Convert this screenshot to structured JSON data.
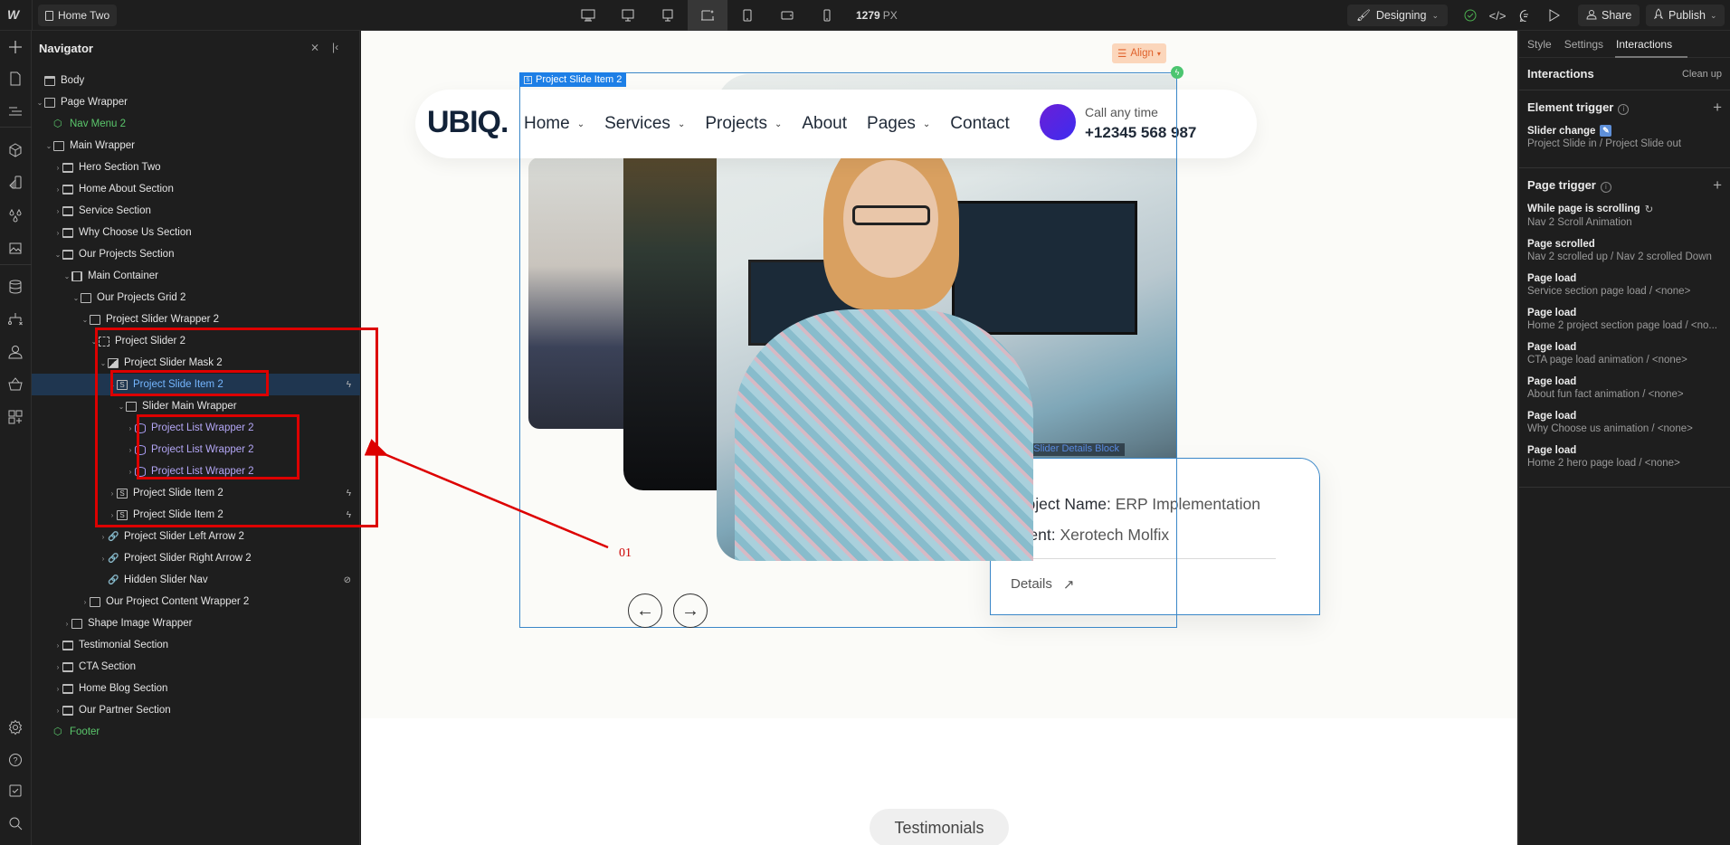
{
  "topbar": {
    "page_name": "Home Two",
    "devices": [
      "desktop-large-icon",
      "desktop-icon",
      "desktop-base-icon",
      "laptop-star-icon",
      "tablet-icon",
      "mobile-landscape-icon",
      "mobile-portrait-icon"
    ],
    "width_value": "1279",
    "width_unit": "PX",
    "mode_label": "Designing",
    "share_label": "Share",
    "publish_label": "Publish"
  },
  "navigator": {
    "title": "Navigator",
    "items": [
      {
        "label": "Body",
        "depth": 0,
        "icon": "body",
        "caret": "",
        "color": ""
      },
      {
        "label": "Page Wrapper",
        "depth": 0,
        "icon": "box",
        "caret": "down",
        "color": ""
      },
      {
        "label": "Nav Menu 2",
        "depth": 1,
        "icon": "component",
        "caret": "",
        "color": "green"
      },
      {
        "label": "Main Wrapper",
        "depth": 1,
        "icon": "box",
        "caret": "down",
        "color": ""
      },
      {
        "label": "Hero Section  Two",
        "depth": 2,
        "icon": "section",
        "caret": "right",
        "color": ""
      },
      {
        "label": "Home About Section",
        "depth": 2,
        "icon": "section",
        "caret": "right",
        "color": ""
      },
      {
        "label": "Service Section",
        "depth": 2,
        "icon": "section",
        "caret": "right",
        "color": ""
      },
      {
        "label": "Why Choose Us Section",
        "depth": 2,
        "icon": "section",
        "caret": "right",
        "color": ""
      },
      {
        "label": "Our Projects Section",
        "depth": 2,
        "icon": "section",
        "caret": "down",
        "color": ""
      },
      {
        "label": "Main Container",
        "depth": 3,
        "icon": "container",
        "caret": "down",
        "color": ""
      },
      {
        "label": "Our Projects Grid 2",
        "depth": 4,
        "icon": "box",
        "caret": "down",
        "color": ""
      },
      {
        "label": "Project Slider Wrapper 2",
        "depth": 5,
        "icon": "box",
        "caret": "down",
        "color": ""
      },
      {
        "label": "Project Slider 2",
        "depth": 6,
        "icon": "slider",
        "caret": "down",
        "color": ""
      },
      {
        "label": "Project Slider Mask 2",
        "depth": 7,
        "icon": "mask",
        "caret": "down",
        "color": ""
      },
      {
        "label": "Project Slide Item 2",
        "depth": 8,
        "icon": "slide",
        "caret": "down",
        "color": "blue",
        "selected": true,
        "bolt": true
      },
      {
        "label": "Slider Main Wrapper",
        "depth": 9,
        "icon": "box",
        "caret": "down",
        "color": ""
      },
      {
        "label": "Project List Wrapper 2",
        "depth": 10,
        "icon": "collection",
        "caret": "right",
        "color": "purple"
      },
      {
        "label": "Project List Wrapper 2",
        "depth": 10,
        "icon": "collection",
        "caret": "right",
        "color": "purple"
      },
      {
        "label": "Project List Wrapper 2",
        "depth": 10,
        "icon": "collection",
        "caret": "right",
        "color": "purple"
      },
      {
        "label": "Project Slide Item 2",
        "depth": 8,
        "icon": "slide",
        "caret": "right",
        "color": "",
        "bolt": true
      },
      {
        "label": "Project Slide Item 2",
        "depth": 8,
        "icon": "slide",
        "caret": "right",
        "color": "",
        "bolt": true
      },
      {
        "label": "Project Slider Left Arrow 2",
        "depth": 7,
        "icon": "link",
        "caret": "right",
        "color": ""
      },
      {
        "label": "Project Slider Right Arrow 2",
        "depth": 7,
        "icon": "link",
        "caret": "right",
        "color": ""
      },
      {
        "label": "Hidden Slider Nav",
        "depth": 7,
        "icon": "link",
        "caret": "",
        "color": "",
        "hidden": true
      },
      {
        "label": "Our Project Content Wrapper 2",
        "depth": 5,
        "icon": "box",
        "caret": "right",
        "color": ""
      },
      {
        "label": "Shape Image Wrapper",
        "depth": 3,
        "icon": "box",
        "caret": "right",
        "color": ""
      },
      {
        "label": "Testimonial Section",
        "depth": 2,
        "icon": "section",
        "caret": "right",
        "color": ""
      },
      {
        "label": "CTA Section",
        "depth": 2,
        "icon": "section",
        "caret": "right",
        "color": ""
      },
      {
        "label": "Home Blog Section",
        "depth": 2,
        "icon": "section",
        "caret": "right",
        "color": ""
      },
      {
        "label": "Our Partner Section",
        "depth": 2,
        "icon": "section",
        "caret": "right",
        "color": ""
      },
      {
        "label": "Footer",
        "depth": 1,
        "icon": "component",
        "caret": "",
        "color": "green"
      }
    ]
  },
  "canvas": {
    "selected_label": "Project Slide Item 2",
    "align_label": "Align",
    "site_nav": {
      "brand": "UBIQ.",
      "menu": [
        {
          "label": "Home",
          "dropdown": true
        },
        {
          "label": "Services",
          "dropdown": true
        },
        {
          "label": "Projects",
          "dropdown": true
        },
        {
          "label": "About",
          "dropdown": false
        },
        {
          "label": "Pages",
          "dropdown": true
        },
        {
          "label": "Contact",
          "dropdown": false
        }
      ],
      "call_label": "Call any time",
      "call_number": "+12345 568 987"
    },
    "details_block_tag": "Project Slider Details Block",
    "details": {
      "name_label": "Project Name:",
      "name_value": "ERP Implementation",
      "client_label": "Client:",
      "client_value": "Xerotech Molfix",
      "link_label": "Details"
    },
    "testimonials_pill": "Testimonials",
    "annotation_number": "01"
  },
  "right_panel": {
    "tabs": [
      "Style",
      "Settings",
      "Interactions"
    ],
    "active_tab": "Interactions",
    "header": "Interactions",
    "cleanup_label": "Clean up",
    "element_trigger": {
      "title": "Element trigger",
      "items": [
        {
          "title": "Slider change",
          "subtitle": "Project Slide in / Project Slide out"
        }
      ]
    },
    "page_trigger": {
      "title": "Page trigger",
      "items": [
        {
          "title": "While page is scrolling",
          "subtitle": "Nav 2 Scroll Animation"
        },
        {
          "title": "Page scrolled",
          "subtitle": "Nav 2 scrolled up / Nav 2 scrolled Down"
        },
        {
          "title": "Page load",
          "subtitle": "Service section page load / <none>"
        },
        {
          "title": "Page load",
          "subtitle": "Home 2 project section page load / <no..."
        },
        {
          "title": "Page load",
          "subtitle": "CTA page load animation / <none>"
        },
        {
          "title": "Page load",
          "subtitle": "About fun fact animation / <none>"
        },
        {
          "title": "Page load",
          "subtitle": "Why Choose us animation / <none>"
        },
        {
          "title": "Page load",
          "subtitle": "Home 2 hero page load / <none>"
        }
      ]
    }
  },
  "colors": {
    "selection_blue": "#1d7fe6",
    "annotation_red": "#dd0000",
    "component_green": "#5ac66b",
    "collection_purple": "#b4a7f7",
    "align_orange": "#e0622c"
  }
}
